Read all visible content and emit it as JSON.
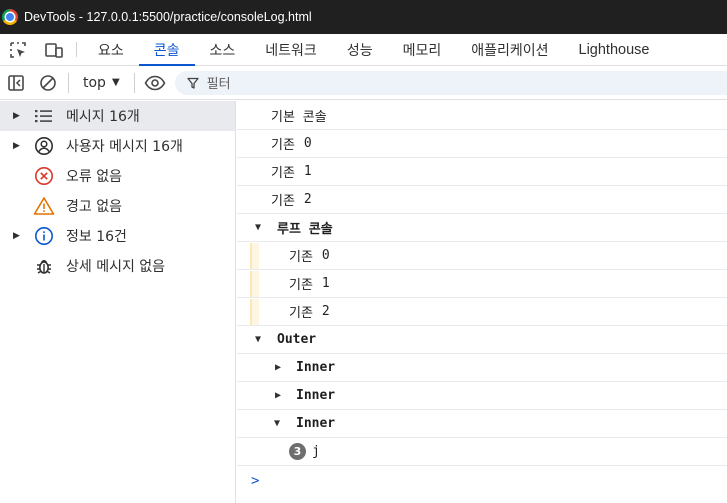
{
  "window": {
    "title": "DevTools - 127.0.0.1:5500/practice/consoleLog.html"
  },
  "tabs": [
    {
      "label": "요소"
    },
    {
      "label": "콘솔"
    },
    {
      "label": "소스"
    },
    {
      "label": "네트워크"
    },
    {
      "label": "성능"
    },
    {
      "label": "메모리"
    },
    {
      "label": "애플리케이션"
    },
    {
      "label": "Lighthouse"
    }
  ],
  "active_tab": "콘솔",
  "toolbar": {
    "context": "top",
    "filter_placeholder": "필터"
  },
  "sidebar": {
    "items": [
      {
        "label": "메시지 16개",
        "icon": "list-icon",
        "expandable": true,
        "selected": true
      },
      {
        "label": "사용자 메시지 16개",
        "icon": "user-icon",
        "expandable": true
      },
      {
        "label": "오류 없음",
        "icon": "error-icon",
        "expandable": false
      },
      {
        "label": "경고 없음",
        "icon": "warning-icon",
        "expandable": false
      },
      {
        "label": "정보 16건",
        "icon": "info-icon",
        "expandable": true
      },
      {
        "label": "상세 메시지 없음",
        "icon": "bug-icon",
        "expandable": false
      }
    ]
  },
  "console": {
    "rows": [
      {
        "text": "기본 콘솔"
      },
      {
        "text": "기존",
        "num": "0"
      },
      {
        "text": "기존",
        "num": "1"
      },
      {
        "text": "기존",
        "num": "2"
      },
      {
        "text": "루프 콘솔",
        "group": "expanded"
      },
      {
        "text": "기존",
        "num": "0"
      },
      {
        "text": "기존",
        "num": "1"
      },
      {
        "text": "기존",
        "num": "2"
      },
      {
        "text": "Outer",
        "group": "expanded"
      },
      {
        "text": "Inner",
        "group": "collapsed"
      },
      {
        "text": "Inner",
        "group": "collapsed"
      },
      {
        "text": "Inner",
        "group": "expanded"
      },
      {
        "text": "j",
        "count": "3"
      }
    ],
    "prompt": ">"
  },
  "colors": {
    "accent": "#0b57d0",
    "number": "#1a1aa6",
    "error": "#dc362e",
    "warning": "#e37400",
    "info": "#0b57d0"
  }
}
